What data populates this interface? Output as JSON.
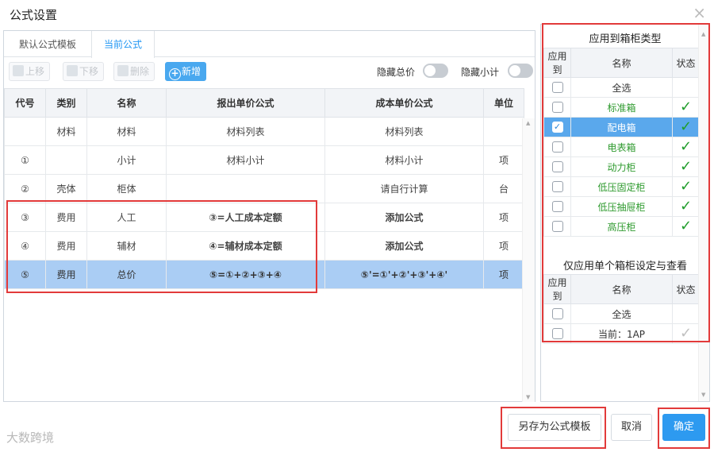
{
  "dialog": {
    "title": "公式设置",
    "close_glyph": "×"
  },
  "tabs": [
    {
      "label": "默认公式模板"
    },
    {
      "label": "当前公式",
      "active": true
    }
  ],
  "toolbar": {
    "up_label": "上移",
    "down_label": "下移",
    "delete_label": "删除",
    "add_label": "新增",
    "hide_total_label": "隐藏总价",
    "hide_subtotal_label": "隐藏小计",
    "hide_total_on": false,
    "hide_subtotal_on": false
  },
  "grid": {
    "headers": [
      "代号",
      "类别",
      "名称",
      "报出单价公式",
      "成本单价公式",
      "单位"
    ],
    "rows": [
      {
        "code": "",
        "category": "材料",
        "name": "材料",
        "quote_formula": "材料列表",
        "cost_formula": "材料列表",
        "unit": ""
      },
      {
        "code": "①",
        "category": "",
        "name": "小计",
        "quote_formula": "材料小计",
        "cost_formula": "材料小计",
        "unit": "项"
      },
      {
        "code": "②",
        "category": "壳体",
        "name": "柜体",
        "quote_formula": "",
        "cost_formula": "请自行计算",
        "unit": "台"
      },
      {
        "code": "③",
        "category": "费用",
        "name": "人工",
        "quote_formula": "③=人工成本定额",
        "cost_formula": "添加公式",
        "unit": "项"
      },
      {
        "code": "④",
        "category": "费用",
        "name": "辅材",
        "quote_formula": "④=辅材成本定额",
        "cost_formula": "添加公式",
        "unit": "项"
      },
      {
        "code": "⑤",
        "category": "费用",
        "name": "总价",
        "quote_formula": "⑤=①+②+③+④",
        "cost_formula": "⑤'=①'+②'+③'+④'",
        "unit": "项",
        "selected": true
      }
    ]
  },
  "right_panel": {
    "section1_title": "应用到箱柜类型",
    "section2_title": "仅应用单个箱柜设定与查看",
    "headers": [
      "应用到",
      "名称",
      "状态"
    ],
    "types": [
      {
        "name": "全选",
        "checked": false,
        "status": ""
      },
      {
        "name": "标准箱",
        "checked": false,
        "status": "✓"
      },
      {
        "name": "配电箱",
        "checked": true,
        "status": "✓"
      },
      {
        "name": "电表箱",
        "checked": false,
        "status": "✓"
      },
      {
        "name": "动力柜",
        "checked": false,
        "status": "✓"
      },
      {
        "name": "低压固定柜",
        "checked": false,
        "status": "✓"
      },
      {
        "name": "低压抽屉柜",
        "checked": false,
        "status": "✓"
      },
      {
        "name": "高压柜",
        "checked": false,
        "status": "✓"
      }
    ],
    "single": [
      {
        "name": "全选",
        "checked": false,
        "status": ""
      },
      {
        "name": "当前：1AP",
        "checked": false,
        "status": "✓"
      }
    ]
  },
  "footer": {
    "save_template_label": "另存为公式模板",
    "cancel_label": "取消",
    "ok_label": "确定"
  },
  "watermark": "大数跨境",
  "colors": {
    "accent": "#2d9af0",
    "highlight": "#e23a3a",
    "selected_row": "#aacdf4",
    "check_green": "#1f9d2b"
  }
}
